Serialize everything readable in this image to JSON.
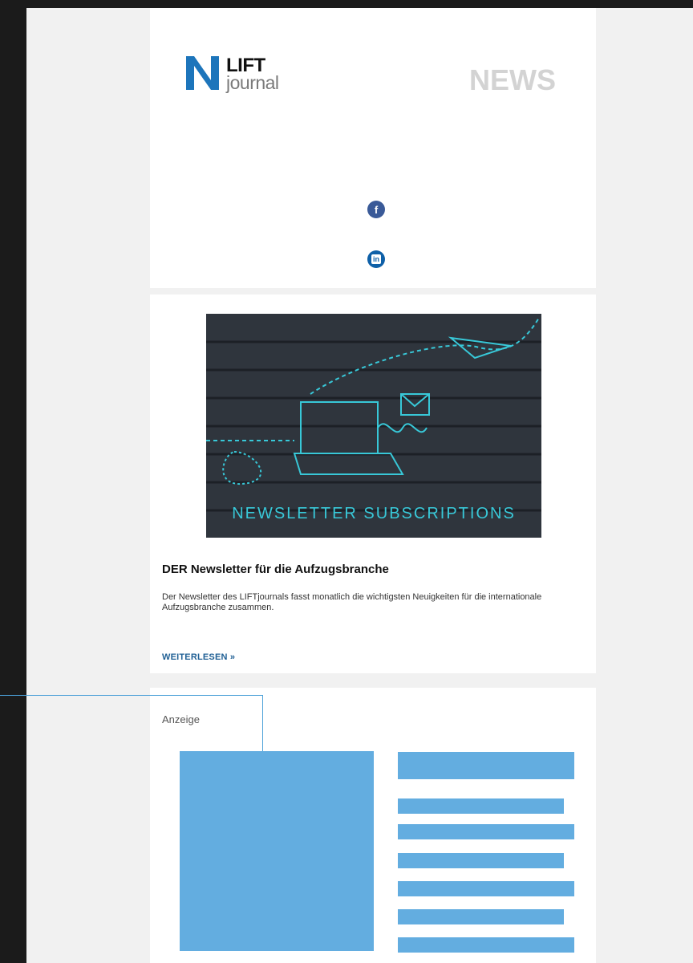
{
  "header": {
    "logo": {
      "line1": "LIFT",
      "line2": "journal"
    },
    "news_label": "NEWS",
    "social_icons": [
      "facebook-icon",
      "linkedin-icon"
    ]
  },
  "article": {
    "image_caption": "NEWSLETTER SUBSCRIPTIONS",
    "title": "DER Newsletter für die Aufzugsbranche",
    "text": "Der Newsletter des LIFTjournals fasst monatlich die wichtigsten Neuigkeiten für die internationale Aufzugsbranche zusammen.",
    "read_more": "WEITERLESEN »"
  },
  "ad": {
    "label": "Anzeige"
  },
  "colors": {
    "accent": "#63ade0",
    "link": "#1f5f94",
    "logo_blue": "#1d75bb"
  }
}
